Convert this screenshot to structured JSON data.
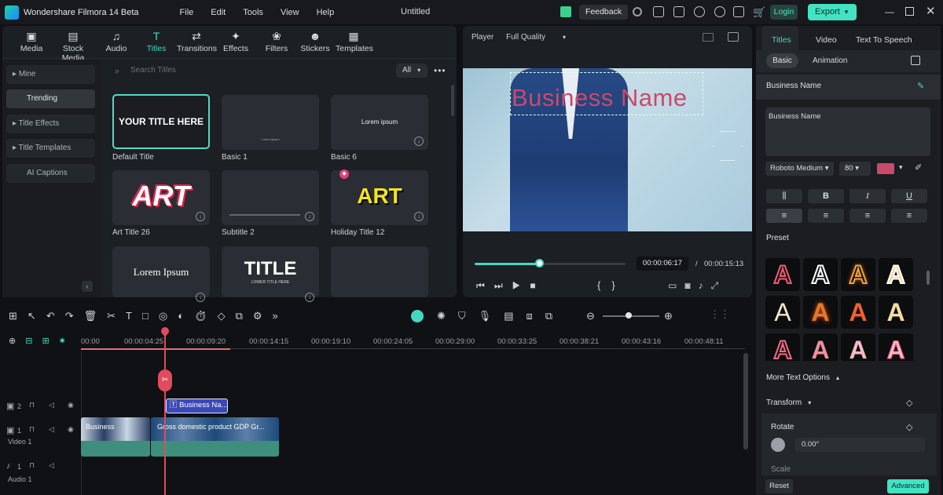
{
  "app": {
    "name": "Wondershare Filmora 14 Beta",
    "doc_title": "Untitled",
    "feedback": "Feedback",
    "login": "Login",
    "export": "Export"
  },
  "menu": [
    "File",
    "Edit",
    "Tools",
    "View",
    "Help"
  ],
  "library": {
    "tabs": [
      {
        "label": "Media",
        "icon": "media-icon"
      },
      {
        "label": "Stock Media",
        "icon": "stock-media-icon"
      },
      {
        "label": "Audio",
        "icon": "music-icon"
      },
      {
        "label": "Titles",
        "icon": "titles-icon"
      },
      {
        "label": "Transitions",
        "icon": "transitions-icon"
      },
      {
        "label": "Effects",
        "icon": "effects-icon"
      },
      {
        "label": "Filters",
        "icon": "filters-icon"
      },
      {
        "label": "Stickers",
        "icon": "stickers-icon"
      },
      {
        "label": "Templates",
        "icon": "templates-icon"
      }
    ],
    "categories": [
      "Mine",
      "Trending",
      "Title Effects",
      "Title Templates",
      "AI Captions"
    ],
    "search_placeholder": "Search Titles",
    "filter": "All",
    "cards": [
      {
        "caption": "Default Title",
        "preview": "YOUR TITLE HERE"
      },
      {
        "caption": "Basic 1",
        "preview": "Lorem ipsum"
      },
      {
        "caption": "Basic 6",
        "preview": "Lorem ipsum"
      },
      {
        "caption": "Art Title 26",
        "preview": "ART"
      },
      {
        "caption": "Subtitle 2",
        "preview": ""
      },
      {
        "caption": "Holiday Title 12",
        "preview": "ART"
      },
      {
        "caption": "",
        "preview": "Lorem Ipsum"
      },
      {
        "caption": "",
        "preview": "TITLE",
        "sub": "LOWER TITLE HERE"
      },
      {
        "caption": "",
        "preview": ""
      }
    ]
  },
  "player": {
    "label": "Player",
    "quality": "Full Quality",
    "overlay_text": "Business Name",
    "current_time": "00:00:06:17",
    "separator": "/",
    "total_time": "00:00:15:13",
    "progress": 0.42
  },
  "timeline": {
    "ticks": [
      "00:00",
      "00:00:04:25",
      "00:00:09:20",
      "00:00:14:15",
      "00:00:19:10",
      "00:00:24:05",
      "00:00:29:00",
      "00:00:33:25",
      "00:00:38:21",
      "00:00:43:16",
      "00:00:48:11"
    ],
    "title_clip": "Business Na...",
    "video_clip_1": "Business",
    "video_clip_2": "Gross domestic product GDP Gr...",
    "track_labels": {
      "track2": "2",
      "video1_num": "1",
      "video1": "Video 1",
      "audio1_num": "1",
      "audio1": "Audio 1"
    }
  },
  "properties": {
    "tabs": [
      "Titles",
      "Video",
      "Text To Speech"
    ],
    "subtabs": [
      "Basic",
      "Animation"
    ],
    "section_title": "Business Name",
    "text_value": "Business Name",
    "font": "Roboto Medium",
    "size": "80",
    "color": "#c94a6a",
    "style_buttons": [
      "B",
      "I",
      "U"
    ],
    "preset_label": "Preset",
    "more_options": "More Text Options",
    "transform": "Transform",
    "rotate": "Rotate",
    "rotate_value": "0.00°",
    "scale": "Scale",
    "reset": "Reset",
    "advanced": "Advanced"
  }
}
